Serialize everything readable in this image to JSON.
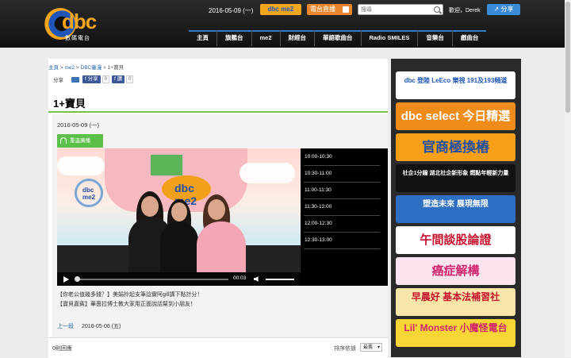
{
  "header": {
    "logo_text": "dbc",
    "logo_sub": "數碼電台",
    "date": "2016-05-09 (一)",
    "radio_badge": "dbc me2",
    "live_label": "電台直播",
    "search_placeholder": "搜尋",
    "welcome": "歡迎，Derek",
    "share_label": "分享"
  },
  "nav": [
    "主頁",
    "旗艦台",
    "me2",
    "財經台",
    "華語歌曲台",
    "Radio SMILES",
    "音樂台",
    "戲曲台"
  ],
  "breadcrumb": {
    "home": "主頁",
    "sep1": " > ",
    "me2": "me2",
    "sep2": " > ",
    "channel": "DBC童漫",
    "sep3": " > ",
    "current": "1+寶貝"
  },
  "share": {
    "label": "分享",
    "fb_share": "分享",
    "fb_share_count": "0",
    "fb_like": "讚",
    "fb_like_count": "0"
  },
  "page_title": "1+寶貝",
  "episode": {
    "date": "2016-05-09 (一)",
    "player_tab": "重溫廣播",
    "time_display": "00:03",
    "video_logo": "dbc me2",
    "schedule": [
      "10:00-10:30",
      "10:30-11:00",
      "11:00-11:30",
      "11:30-12:00",
      "12:00-12:30",
      "12:30-13:00"
    ],
    "desc_line1": "【你老公值幾多錢？】美娟拎起支筆諗實阿gill講下點計分！",
    "desc_line2": "【寶貝嘉賓】華茵拉博士教大家用正面說話幫到小朋友！",
    "prev_label": "上一段",
    "prev_date": "2016-05-06 (五)"
  },
  "comments": {
    "count": "0則回應",
    "sort_label": "排序依據",
    "sort_value": "最舊"
  },
  "sidebar": {
    "banners": [
      {
        "text": "dbc 登陸 LeEco 樂視 191及193頻道",
        "bg": "#ffffff",
        "fg": "#1f56b8"
      },
      {
        "text": "dbc select 今日精選",
        "bg": "#f08c1a",
        "fg": "#ffffff"
      },
      {
        "text": "官商極換樁",
        "bg": "#f6a019",
        "fg": "#1c4fa3"
      },
      {
        "text": "社企1分鐘 湖北社企新形象 燃點年輕新力量",
        "bg": "#121212",
        "fg": "#ffffff"
      },
      {
        "text": "塑造未來 展現無限",
        "bg": "#2d6fc2",
        "fg": "#ffffff"
      },
      {
        "text": "午間談股論證",
        "bg": "#ffffff",
        "fg": "#c8102e"
      },
      {
        "text": "癌症解構",
        "bg": "#fbe3ef",
        "fg": "#d2246d"
      },
      {
        "text": "早晨好 基本法補習社",
        "bg": "#f7e6a8",
        "fg": "#c8102e"
      },
      {
        "text": "Lil' Monster 小魔怪電台",
        "bg": "#f6d634",
        "fg": "#d2246d"
      }
    ]
  }
}
